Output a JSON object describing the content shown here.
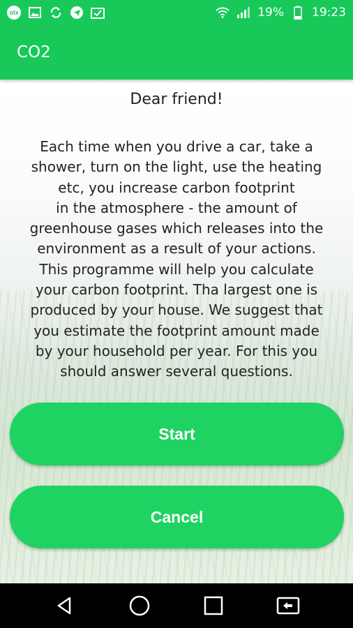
{
  "status_bar": {
    "left_icons": [
      "olx-icon",
      "gallery-icon",
      "sync-icon",
      "telegram-icon",
      "photo-check-icon"
    ],
    "battery": "19%",
    "time": "19:23"
  },
  "app_bar": {
    "title": "CO2"
  },
  "main": {
    "greeting": "Dear friend!",
    "intro_lines": [
      "Each time when you drive a car, take a",
      "shower, turn on the light, use the heating",
      "etc, you increase carbon footprint",
      "in the atmosphere - the amount of",
      "greenhouse gases which releases into the",
      "environment as a result of your actions.",
      "This programme will help you calculate",
      "your carbon footprint. Tha largest one is",
      "produced by your house. We suggest that",
      "you estimate the footprint amount made",
      "by your household per year. For this you",
      "should answer several questions."
    ],
    "start_label": "Start",
    "cancel_label": "Cancel"
  },
  "colors": {
    "accent": "#18c95a",
    "button": "#1fd362"
  },
  "nav_bar": {
    "icons": [
      "back-icon",
      "home-icon",
      "recents-icon",
      "screen-cast-icon"
    ]
  }
}
